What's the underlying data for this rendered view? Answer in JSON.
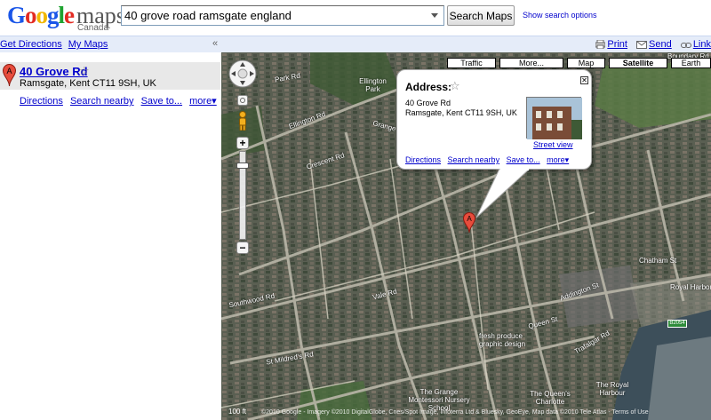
{
  "header": {
    "logo_google": "Google",
    "logo_maps": "maps",
    "logo_region": "Canada",
    "search_value": "40 grove road ramsgate england",
    "search_button": "Search Maps",
    "search_options": "Show search options"
  },
  "toolbar": {
    "get_directions": "Get Directions",
    "my_maps": "My Maps",
    "collapse": "«",
    "print": "Print",
    "send": "Send",
    "link": "Link"
  },
  "result": {
    "marker_letter": "A",
    "title": "40 Grove Rd",
    "star": "☆",
    "address": "Ramsgate, Kent CT11 9SH, UK",
    "links": [
      "Directions",
      "Search nearby",
      "Save to...",
      "more▾"
    ]
  },
  "map": {
    "type_buttons": [
      {
        "label": "Traffic",
        "selected": false
      },
      {
        "label": "More...",
        "selected": false
      },
      {
        "label": "Map",
        "selected": false
      },
      {
        "label": "Satellite",
        "selected": true
      },
      {
        "label": "Earth",
        "selected": false
      }
    ],
    "pan_zoom": {
      "plus": "+",
      "minus": "−"
    },
    "infowindow": {
      "label": "Address:",
      "star": "☆",
      "line1": "40 Grove Rd",
      "line2": "Ramsgate, Kent CT11 9SH, UK",
      "street_view": "Street view",
      "close": "✕",
      "links": [
        "Directions",
        "Search nearby",
        "Save to...",
        "more▾"
      ]
    },
    "marker_letter": "A",
    "scale": "100 ft",
    "attribution": "©2010 Google - Imagery ©2010 DigitalGlobe, Cnes/Spot Image, Infoterra Ltd & Bluesky, GeoEye, Map data ©2010 Tele Atlas - Terms of Use",
    "street_labels": [
      "Park Rd",
      "Ellington Park",
      "Ellington Rd",
      "Grange Rd",
      "Crescent Rd",
      "Southwood Rd",
      "Vale Rd",
      "St Mildred's Rd",
      "Queen St",
      "Boundary Rd",
      "Chatham St",
      "fresh produce graphic design",
      "The Grange Montessori Nursery School",
      "The Queen's Charlotte",
      "The Royal Harbour",
      "Trafalgar Rd",
      "Addington St",
      "Royal Harbour"
    ]
  },
  "colors": {
    "link": "#0000cc",
    "bar_bg": "#e5ecf9",
    "result_bg": "#e8e8e8",
    "marker_red": "#e74c3c"
  }
}
